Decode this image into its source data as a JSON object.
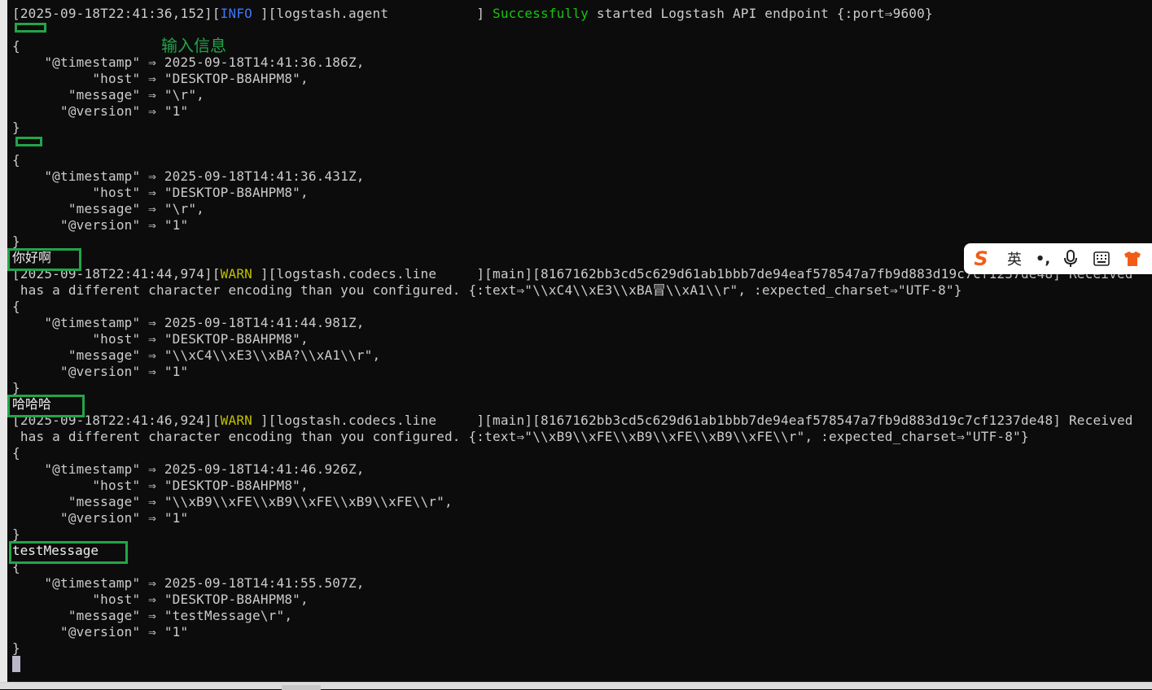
{
  "terminal": {
    "lines": [
      {
        "parts": [
          {
            "t": "[2025-09-18T22:41:36,152]["
          },
          {
            "t": "INFO",
            "c": "info"
          },
          {
            "t": " ][logstash.agent           ] "
          },
          {
            "t": "Successfully",
            "c": "success"
          },
          {
            "t": " started Logstash API endpoint {:port⇒9600}"
          }
        ]
      },
      {
        "parts": [
          {
            "t": ""
          }
        ]
      },
      {
        "parts": [
          {
            "t": "{"
          }
        ]
      },
      {
        "parts": [
          {
            "t": "    \"@timestamp\" ⇒ 2025-09-18T14:41:36.186Z,"
          }
        ]
      },
      {
        "parts": [
          {
            "t": "          \"host\" ⇒ \"DESKTOP-B8AHPM8\","
          }
        ]
      },
      {
        "parts": [
          {
            "t": "       \"message\" ⇒ \"\\r\","
          }
        ]
      },
      {
        "parts": [
          {
            "t": "      \"@version\" ⇒ \"1\""
          }
        ]
      },
      {
        "parts": [
          {
            "t": "}"
          }
        ]
      },
      {
        "parts": [
          {
            "t": ""
          }
        ]
      },
      {
        "parts": [
          {
            "t": "{"
          }
        ]
      },
      {
        "parts": [
          {
            "t": "    \"@timestamp\" ⇒ 2025-09-18T14:41:36.431Z,"
          }
        ]
      },
      {
        "parts": [
          {
            "t": "          \"host\" ⇒ \"DESKTOP-B8AHPM8\","
          }
        ]
      },
      {
        "parts": [
          {
            "t": "       \"message\" ⇒ \"\\r\","
          }
        ]
      },
      {
        "parts": [
          {
            "t": "      \"@version\" ⇒ \"1\""
          }
        ]
      },
      {
        "parts": [
          {
            "t": "}"
          }
        ]
      },
      {
        "parts": [
          {
            "t": ""
          }
        ]
      },
      {
        "parts": [
          {
            "t": "[2025-09-18T22:41:44,974]["
          },
          {
            "t": "WARN",
            "c": "warn"
          },
          {
            "t": " ][logstash.codecs.line     ][main][8167162bb3cd5c629d61ab1bbb7de94eaf578547a7fb9d883d19c7cf1237de48] Received"
          }
        ]
      },
      {
        "parts": [
          {
            "t": " has a different character encoding than you configured. {:text⇒\"\\\\xC4\\\\xE3\\\\xBA冒\\\\xA1\\\\r\", :expected_charset⇒\"UTF-8\"}"
          }
        ]
      },
      {
        "parts": [
          {
            "t": "{"
          }
        ]
      },
      {
        "parts": [
          {
            "t": "    \"@timestamp\" ⇒ 2025-09-18T14:41:44.981Z,"
          }
        ]
      },
      {
        "parts": [
          {
            "t": "          \"host\" ⇒ \"DESKTOP-B8AHPM8\","
          }
        ]
      },
      {
        "parts": [
          {
            "t": "       \"message\" ⇒ \"\\\\xC4\\\\xE3\\\\xBA?\\\\xA1\\\\r\","
          }
        ]
      },
      {
        "parts": [
          {
            "t": "      \"@version\" ⇒ \"1\""
          }
        ]
      },
      {
        "parts": [
          {
            "t": "}"
          }
        ]
      },
      {
        "parts": [
          {
            "t": ""
          }
        ]
      },
      {
        "parts": [
          {
            "t": "[2025-09-18T22:41:46,924]["
          },
          {
            "t": "WARN",
            "c": "warn"
          },
          {
            "t": " ][logstash.codecs.line     ][main][8167162bb3cd5c629d61ab1bbb7de94eaf578547a7fb9d883d19c7cf1237de48] Received"
          }
        ]
      },
      {
        "parts": [
          {
            "t": " has a different character encoding than you configured. {:text⇒\"\\\\xB9\\\\xFE\\\\xB9\\\\xFE\\\\xB9\\\\xFE\\\\r\", :expected_charset⇒\"UTF-8\"}"
          }
        ]
      },
      {
        "parts": [
          {
            "t": "{"
          }
        ]
      },
      {
        "parts": [
          {
            "t": "    \"@timestamp\" ⇒ 2025-09-18T14:41:46.926Z,"
          }
        ]
      },
      {
        "parts": [
          {
            "t": "          \"host\" ⇒ \"DESKTOP-B8AHPM8\","
          }
        ]
      },
      {
        "parts": [
          {
            "t": "       \"message\" ⇒ \"\\\\xB9\\\\xFE\\\\xB9\\\\xFE\\\\xB9\\\\xFE\\\\r\","
          }
        ]
      },
      {
        "parts": [
          {
            "t": "      \"@version\" ⇒ \"1\""
          }
        ]
      },
      {
        "parts": [
          {
            "t": "}"
          }
        ]
      },
      {
        "parts": [
          {
            "t": ""
          }
        ]
      },
      {
        "parts": [
          {
            "t": "{"
          }
        ]
      },
      {
        "parts": [
          {
            "t": "    \"@timestamp\" ⇒ 2025-09-18T14:41:55.507Z,"
          }
        ]
      },
      {
        "parts": [
          {
            "t": "          \"host\" ⇒ \"DESKTOP-B8AHPM8\","
          }
        ]
      },
      {
        "parts": [
          {
            "t": "       \"message\" ⇒ \"testMessage\\r\","
          }
        ]
      },
      {
        "parts": [
          {
            "t": "      \"@version\" ⇒ \"1\""
          }
        ]
      },
      {
        "parts": [
          {
            "t": "}"
          }
        ]
      }
    ],
    "typed_inputs": [
      "你好啊",
      "哈哈哈",
      "testMessage"
    ]
  },
  "annotation": {
    "label": "输入信息",
    "color": "#22a54a"
  },
  "ime_toolbar": {
    "logo": "S",
    "language": "英",
    "punctuation": "•,",
    "icons": [
      "sogou-logo-icon",
      "microphone-icon",
      "keyboard-icon",
      "skin-icon"
    ]
  },
  "colors": {
    "background": "#0c0c0c",
    "text": "#cccccc",
    "info": "#3b78ff",
    "warn": "#c0c000",
    "success": "#16c60c"
  }
}
